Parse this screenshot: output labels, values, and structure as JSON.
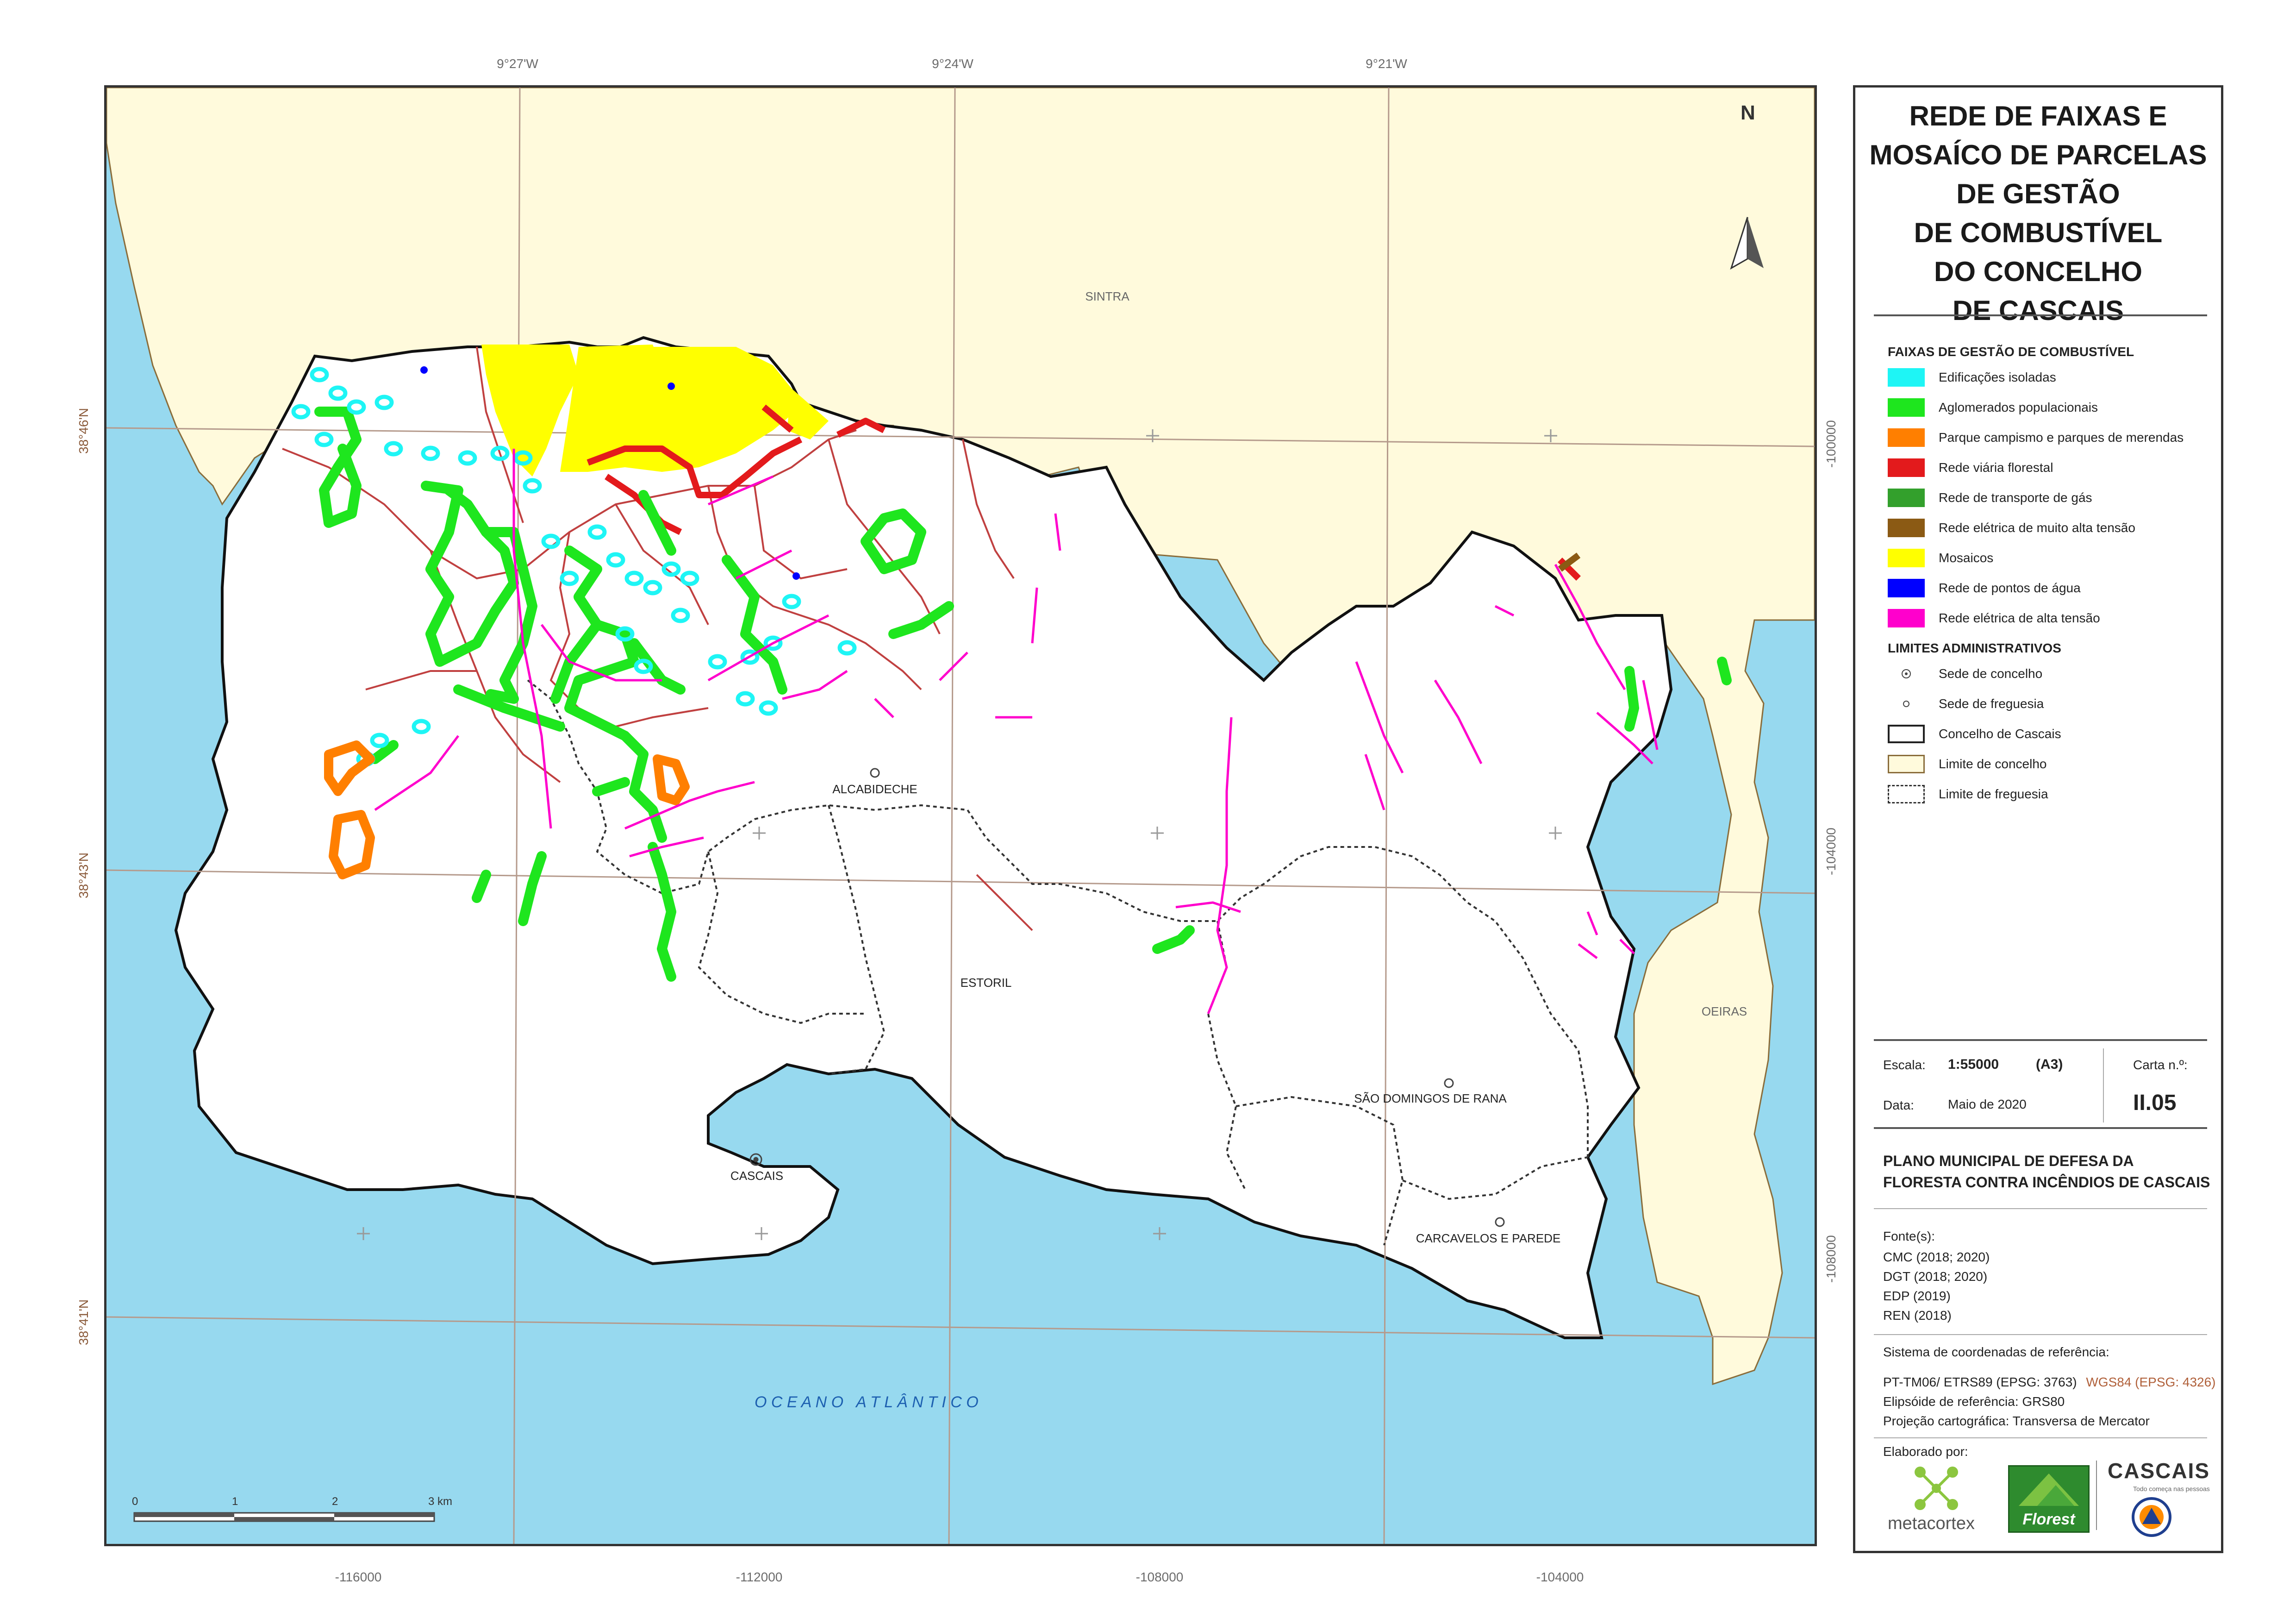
{
  "colors": {
    "sea": "#97d9ef",
    "neighbor_land": "#fffadc",
    "concelho_fill": "#ffffff",
    "edificacoes": "#1ef5f5",
    "aglomerados": "#1ee61e",
    "parque_campismo": "#ff7f00",
    "rede_viaria": "#e31a1c",
    "gas": "#33a02c",
    "muito_alta_tensao": "#8b5a14",
    "mosaicos": "#ffff00",
    "pontos_agua": "#0000ff",
    "alta_tensao": "#ff00cc",
    "road": "#c04040",
    "grid": "#b59a8c"
  },
  "map": {
    "top_coords": [
      "9°27'W",
      "9°24'W",
      "9°21'W"
    ],
    "left_coords": [
      "38°46'N",
      "38°43'N",
      "38°41'N"
    ],
    "bottom_coords": [
      "-116000",
      "-112000",
      "-108000",
      "-104000"
    ],
    "right_coords": [
      "-100000",
      "-104000",
      "-108000"
    ],
    "places": {
      "sintra": "SINTRA",
      "oeiras": "OEIRAS",
      "alcabideche": "ALCABIDECHE",
      "estoril": "ESTORIL",
      "cascais": "CASCAIS",
      "sao_domingos": "SÃO DOMINGOS DE RANA",
      "carcavelos": "CARCAVELOS E PAREDE"
    },
    "ocean_label": "O C E A N O   A T L Â N T I C O",
    "north": "N",
    "scale_ticks": [
      "0",
      "1",
      "2",
      "3 km"
    ]
  },
  "legend": {
    "title": "REDE DE FAIXAS E\nMOSAÍCO DE PARCELAS\nDE GESTÃO\nDE COMBUSTÍVEL\nDO CONCELHO\nDE CASCAIS",
    "faixas_header": "FAIXAS DE GESTÃO DE COMBUSTÍVEL",
    "faixas": [
      "Edificações isoladas",
      "Aglomerados populacionais",
      "Parque campismo e parques de merendas",
      "Rede viária florestal",
      "Rede de transporte de gás",
      "Rede elétrica de muito alta tensão",
      "Mosaicos",
      "Rede de pontos de água",
      "Rede elétrica de alta tensão"
    ],
    "limites_header": "LIMITES ADMINISTRATIVOS",
    "limites": [
      "Sede de concelho",
      "Sede de freguesia",
      "Concelho de Cascais",
      "Limite de concelho",
      "Limite de freguesia"
    ]
  },
  "meta": {
    "escala_label": "Escala:",
    "escala_value": "1:55000",
    "format": "(A3)",
    "carta_label": "Carta n.º:",
    "data_label": "Data:",
    "data_value": "Maio de 2020",
    "carta_value": "II.05"
  },
  "plano": "PLANO MUNICIPAL DE DEFESA DA\nFLORESTA CONTRA INCÊNDIOS DE CASCAIS",
  "fontes": {
    "label": "Fonte(s):",
    "items": [
      "CMC (2018; 2020)",
      "DGT (2018; 2020)",
      "EDP (2019)",
      "REN (2018)"
    ]
  },
  "crs": {
    "label": "Sistema de coordenadas de referência:",
    "line1": "PT-TM06/ ETRS89 (EPSG: 3763)",
    "line1b": "WGS84 (EPSG: 4326)",
    "line2": "Elipsóide de referência: GRS80",
    "line3": "Projeção cartográfica: Transversa de Mercator"
  },
  "credits": {
    "label": "Elaborado por:",
    "metacortex": "metacortex",
    "florest": "Florest",
    "cascais": "CASCAIS",
    "cascais_sub": "Todo começa nas pessoas"
  }
}
